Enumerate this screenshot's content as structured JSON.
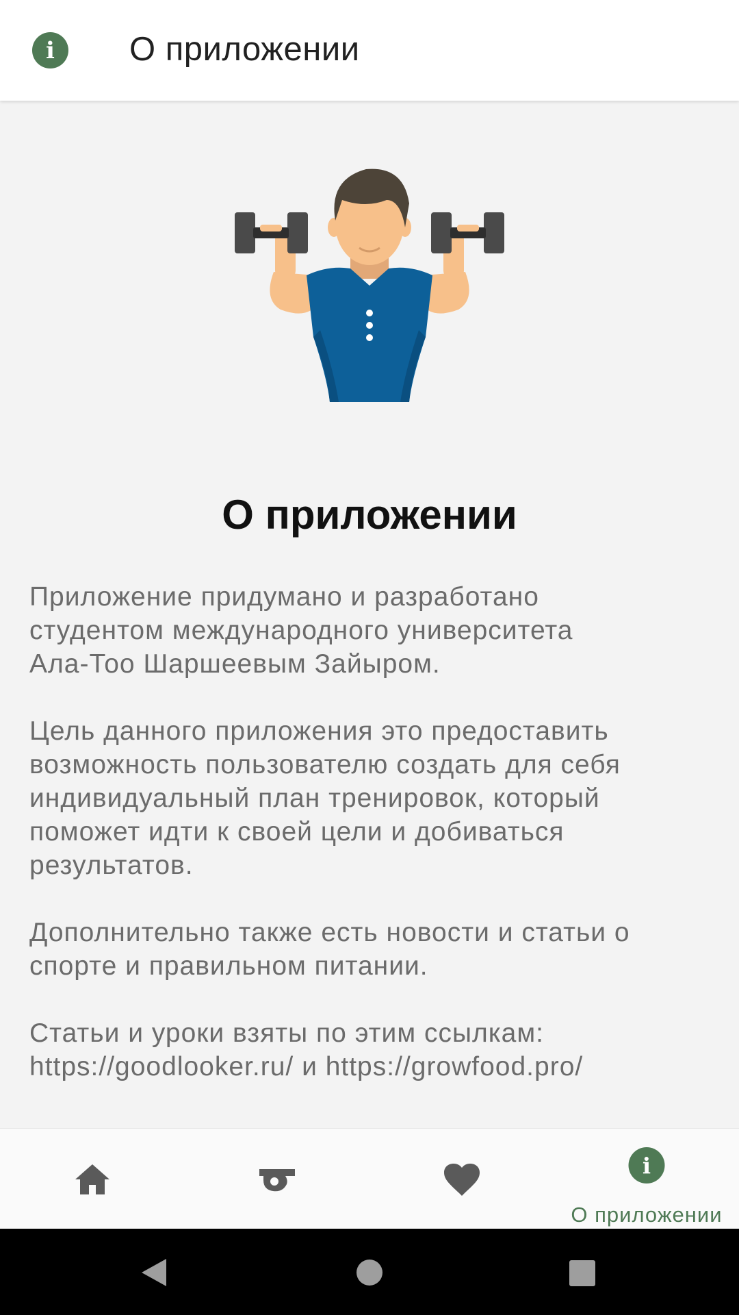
{
  "appbar": {
    "title": "О приложении",
    "icon": "info-icon"
  },
  "content": {
    "illustration": "man-with-dumbbells-illustration",
    "heading": "О приложении",
    "paragraphs": [
      "Приложение придумано и разработано\nстудентом международного университета\nАла-Тоо Шаршеевым Зайыром.",
      "Цель данного приложения это предоставить\nвозможность пользователю создать для себя\nиндивидуальный план тренировок, который\nпоможет идти к своей цели и добиваться\nрезультатов.",
      "Дополнительно также есть новости и статьи о\nспорте и правильном питании.",
      "Статьи и уроки взяты по этим ссылкам:\nhttps://goodlooker.ru/ и https://growfood.pro/"
    ]
  },
  "bottom_nav": {
    "items": [
      {
        "icon": "home-icon",
        "label": ""
      },
      {
        "icon": "whistle-icon",
        "label": ""
      },
      {
        "icon": "heart-icon",
        "label": ""
      },
      {
        "icon": "info-icon",
        "label": "О приложении",
        "active": true
      }
    ]
  },
  "system_nav": {
    "buttons": [
      "back-icon",
      "home-circle-icon",
      "recents-icon"
    ]
  },
  "colors": {
    "accent": "#4f7a55",
    "nav_icon": "#5a5a5a",
    "text": "#6b6b6b",
    "shirt": "#0d6099",
    "skin": "#f7c08a"
  }
}
